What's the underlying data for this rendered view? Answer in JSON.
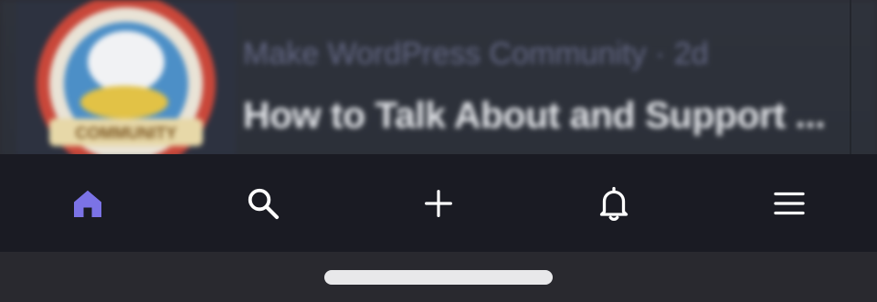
{
  "feed_card": {
    "meta": "Make WordPress Community · 2d",
    "title": "How to Talk About and Support ...",
    "thumbnail_icon": "community-badge-image",
    "thumbnail_text": "COMMUNITY"
  },
  "nav": {
    "items": [
      {
        "name": "home",
        "icon": "home-icon",
        "active": true
      },
      {
        "name": "search",
        "icon": "search-icon",
        "active": false
      },
      {
        "name": "add",
        "icon": "plus-icon",
        "active": false
      },
      {
        "name": "notifications",
        "icon": "bell-icon",
        "active": false
      },
      {
        "name": "menu",
        "icon": "hamburger-menu-icon",
        "active": false
      }
    ]
  },
  "colors": {
    "nav_background": "#1a1b23",
    "active_icon": "#7b73e6",
    "inactive_icon": "#ffffff",
    "card_background": "#2e323b"
  }
}
